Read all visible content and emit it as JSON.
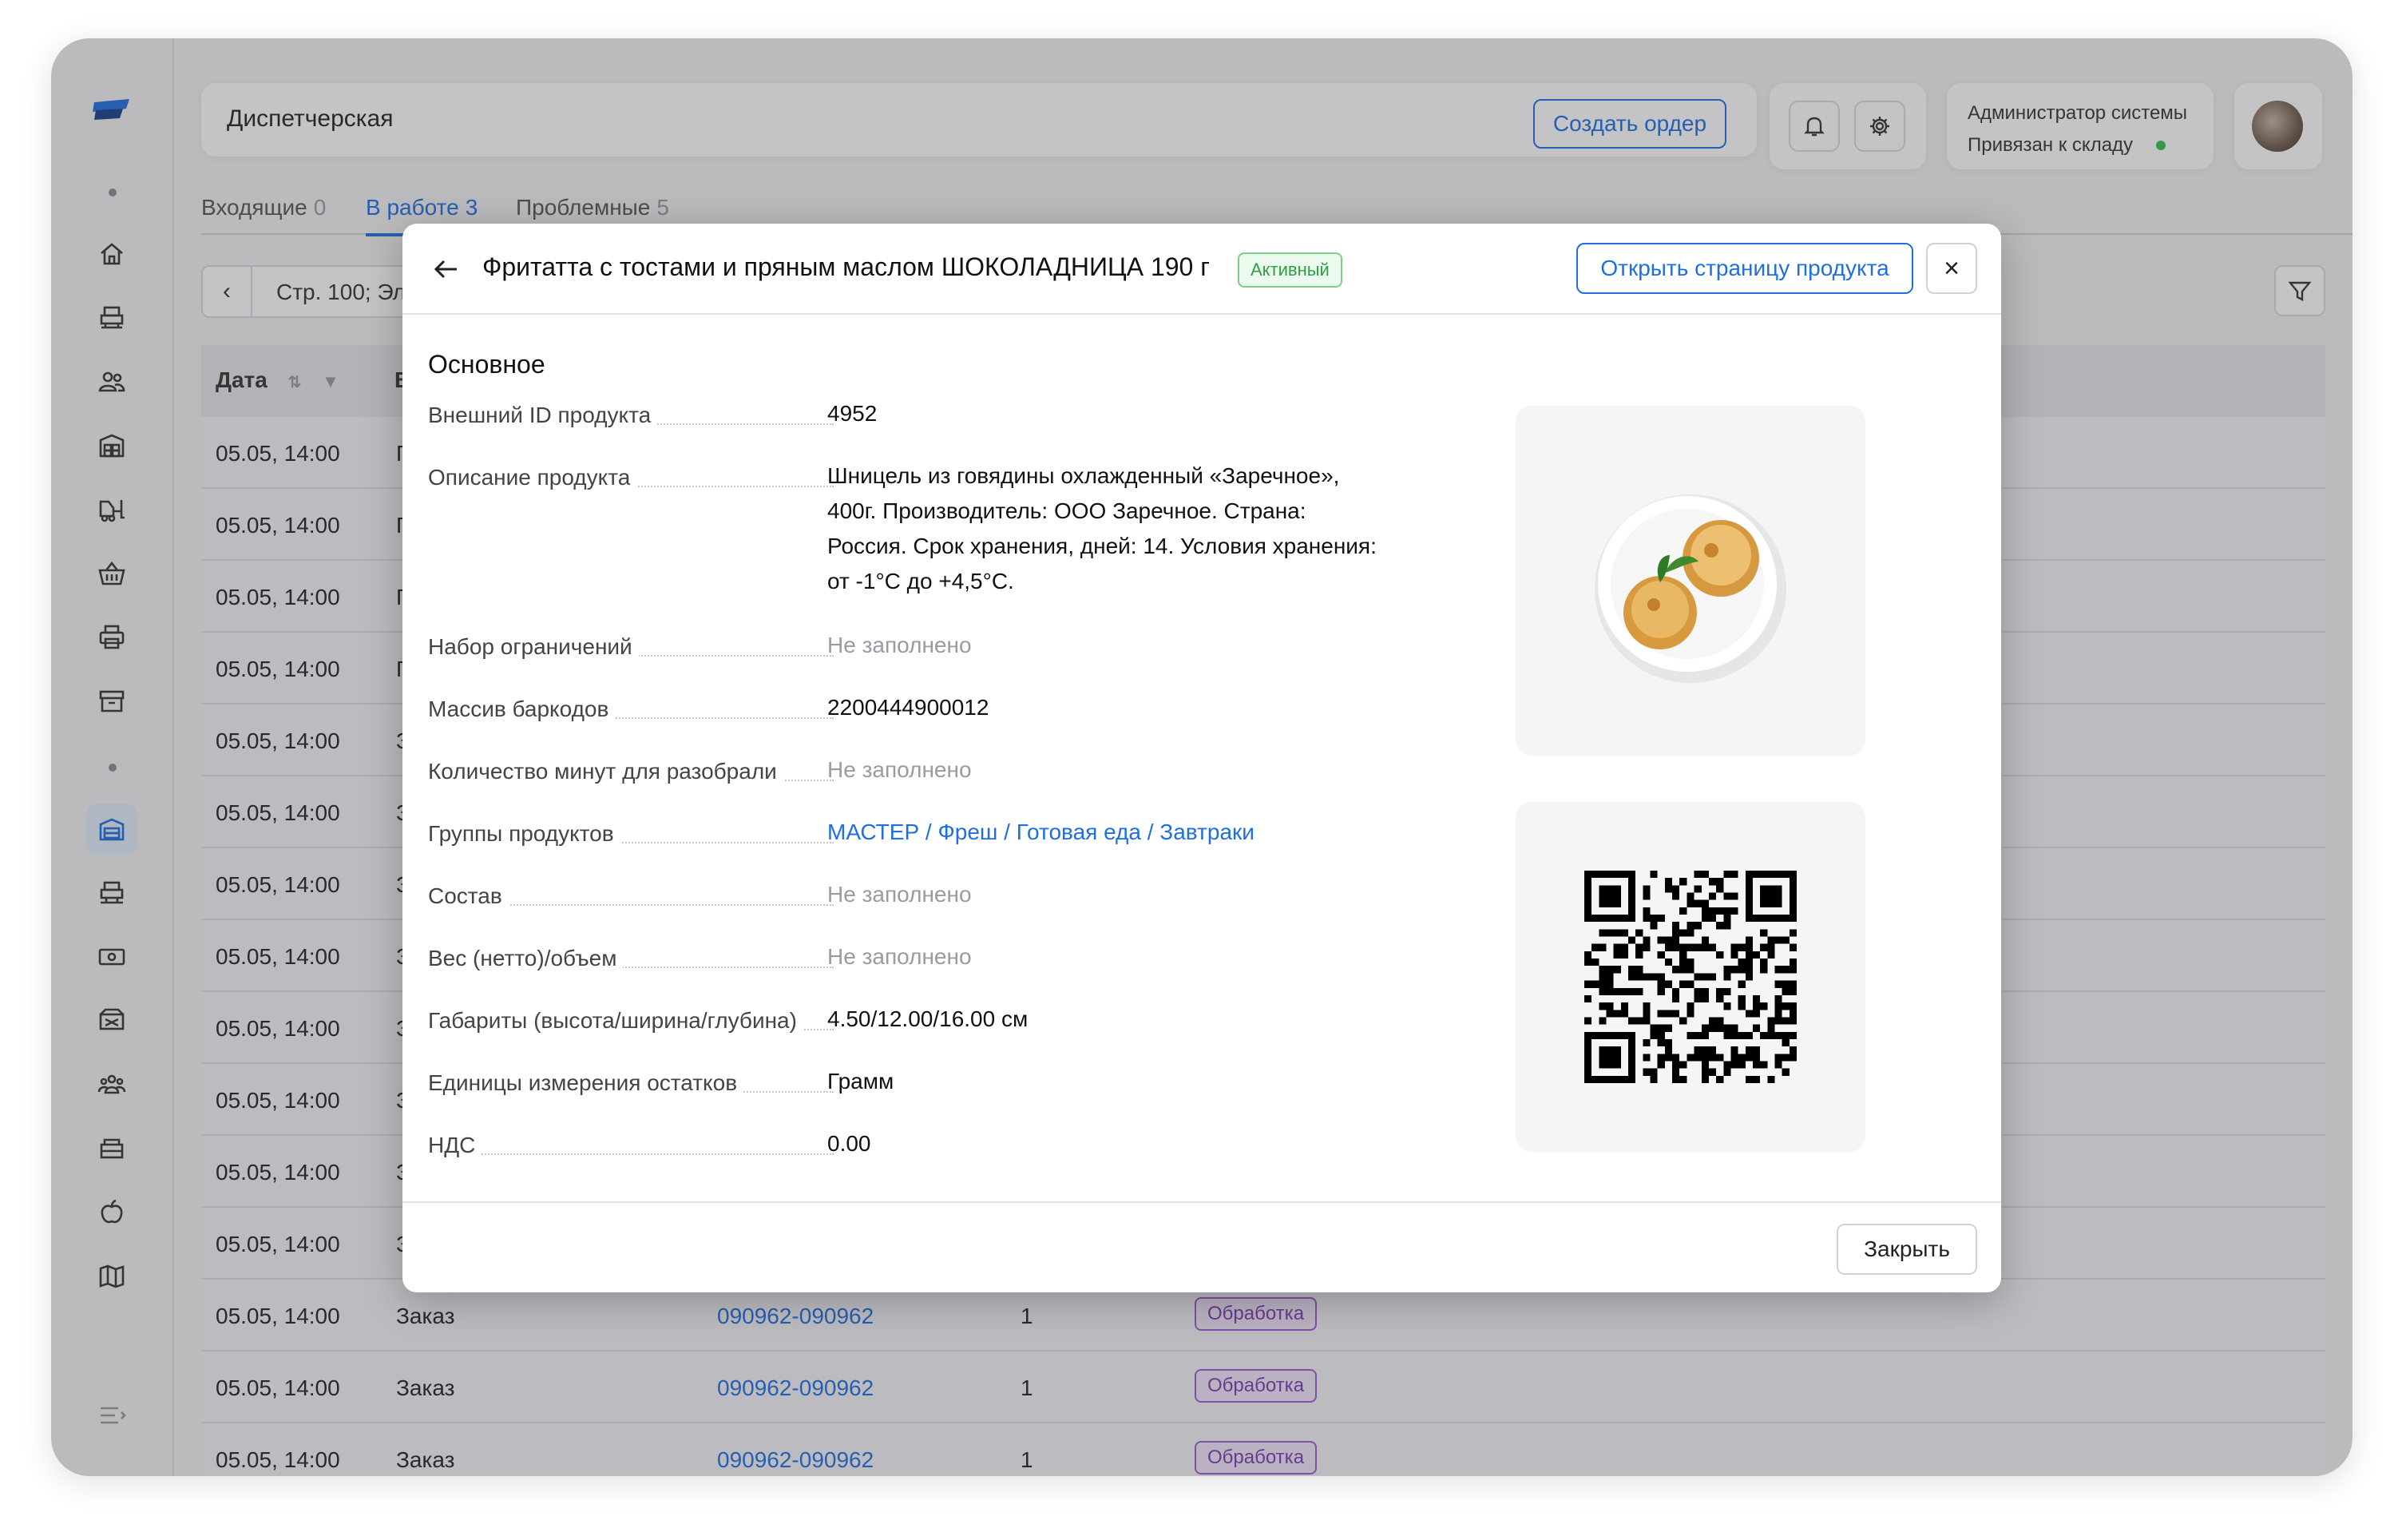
{
  "header": {
    "title": "Диспетчерская",
    "create_order_label": "Создать ордер"
  },
  "user": {
    "role": "Администратор системы",
    "warehouse": "Привязан к складу"
  },
  "tabs": [
    {
      "label": "Входящие",
      "count": "0"
    },
    {
      "label": "В работе",
      "count": "3"
    },
    {
      "label": "Проблемные",
      "count": "5"
    }
  ],
  "pager": {
    "text": "Стр. 100; Эл"
  },
  "table": {
    "col_date": "Дата",
    "col_b": "В",
    "rows": [
      {
        "date": "05.05, 14:00",
        "type": "Г",
        "num": "",
        "qty": "",
        "status": ""
      },
      {
        "date": "05.05, 14:00",
        "type": "Г",
        "num": "",
        "qty": "",
        "status": ""
      },
      {
        "date": "05.05, 14:00",
        "type": "Г",
        "num": "",
        "qty": "",
        "status": ""
      },
      {
        "date": "05.05, 14:00",
        "type": "Г",
        "num": "",
        "qty": "",
        "status": ""
      },
      {
        "date": "05.05, 14:00",
        "type": "З",
        "num": "",
        "qty": "",
        "status": ""
      },
      {
        "date": "05.05, 14:00",
        "type": "З",
        "num": "",
        "qty": "",
        "status": ""
      },
      {
        "date": "05.05, 14:00",
        "type": "З",
        "num": "",
        "qty": "",
        "status": ""
      },
      {
        "date": "05.05, 14:00",
        "type": "З",
        "num": "",
        "qty": "",
        "status": ""
      },
      {
        "date": "05.05, 14:00",
        "type": "З",
        "num": "",
        "qty": "",
        "status": ""
      },
      {
        "date": "05.05, 14:00",
        "type": "З",
        "num": "",
        "qty": "",
        "status": ""
      },
      {
        "date": "05.05, 14:00",
        "type": "З",
        "num": "",
        "qty": "",
        "status": ""
      },
      {
        "date": "05.05, 14:00",
        "type": "З",
        "num": "",
        "qty": "",
        "status": ""
      },
      {
        "date": "05.05, 14:00",
        "type": "Заказ",
        "num": "090962-090962",
        "qty": "1",
        "status": "Обработка"
      },
      {
        "date": "05.05, 14:00",
        "type": "Заказ",
        "num": "090962-090962",
        "qty": "1",
        "status": "Обработка"
      },
      {
        "date": "05.05, 14:00",
        "type": "Заказ",
        "num": "090962-090962",
        "qty": "1",
        "status": "Обработка"
      }
    ]
  },
  "modal": {
    "title": "Фритатта с тостами и пряным маслом ШОКОЛАДНИЦА 190 г",
    "badge": "Активный",
    "open_product_label": "Открыть страницу продукта",
    "close_icon": "×",
    "section": "Основное",
    "fields": [
      {
        "label": "Внешний ID продукта",
        "value": "4952"
      },
      {
        "label": "Описание продукта",
        "value": "Шницель из говядины охлажденный «Заречное», 400г. Производитель: ООО Заречное. Страна: Россия. Срок хранения, дней: 14. Условия хранения: от -1°C до +4,5°C."
      },
      {
        "label": "Набор ограничений",
        "value": "Не заполнено"
      },
      {
        "label": "Массив баркодов",
        "value": "2200444900012"
      },
      {
        "label": "Количество минут для разобрали",
        "value": "Не заполнено"
      },
      {
        "label": "Группы продуктов",
        "value": "МАСТЕР / Фреш / Готовая еда / Завтраки"
      },
      {
        "label": "Состав",
        "value": "Не заполнено"
      },
      {
        "label": "Вес (нетто)/объем",
        "value": "Не заполнено"
      },
      {
        "label": "Габариты (высота/ширина/глубина)",
        "value": "4.50/12.00/16.00 см"
      },
      {
        "label": "Единицы измерения остатков",
        "value": "Грамм"
      },
      {
        "label": "НДС",
        "value": "0.00"
      }
    ],
    "close_label": "Закрыть"
  },
  "icons": {
    "sidebar": [
      "home-icon",
      "printer-stack-icon",
      "users-icon",
      "warehouse-icon",
      "forklift-icon",
      "basket-icon",
      "print-icon",
      "archive-icon",
      "dispatch-icon",
      "station-icon",
      "cash-icon",
      "delivery-icon",
      "team-icon",
      "cart-icon",
      "apple-icon",
      "map-icon"
    ],
    "header": [
      "bell-icon",
      "gear-icon"
    ]
  },
  "colors": {
    "accent": "#1f6fe0",
    "active_badge": "#2f9e44",
    "status_badge": "#7b3bb0",
    "online": "#35c24a"
  }
}
